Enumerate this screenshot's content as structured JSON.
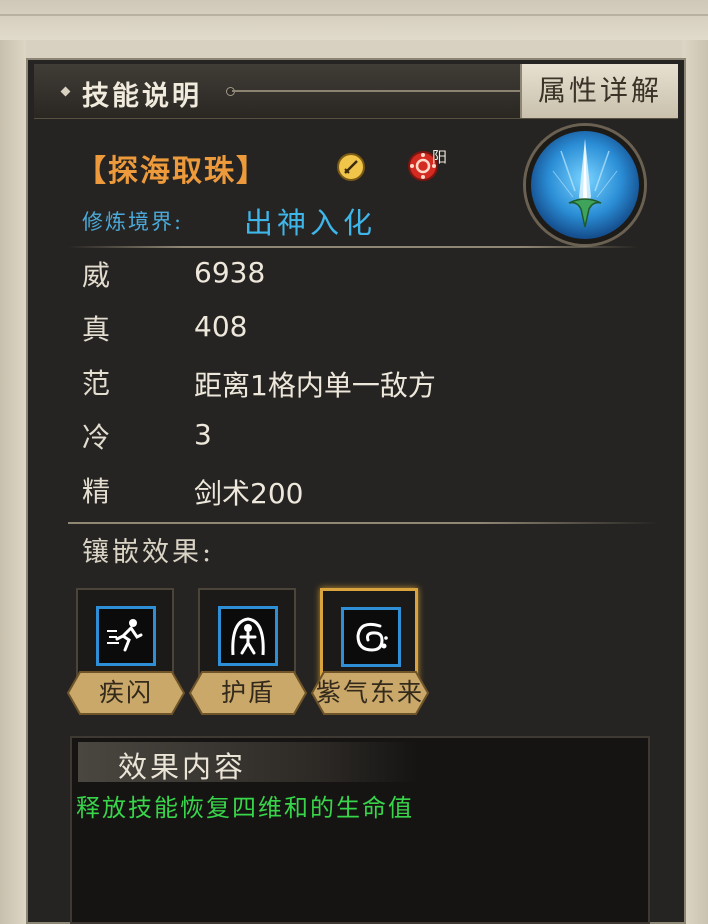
{
  "header": {
    "title": "技能说明",
    "attribute_tab": "属性详解"
  },
  "skill": {
    "name": "【探海取珠】",
    "realm_label": "修炼境界:",
    "realm_value": "出神入化",
    "yang_label": "阳",
    "icons": [
      "sword-type-icon",
      "yang-element-icon",
      "sword-skill-orb-icon"
    ]
  },
  "stats": [
    {
      "key": "威",
      "value": "6938"
    },
    {
      "key": "真",
      "value": "408"
    },
    {
      "key": "范",
      "value": "距离1格内单一敌方"
    },
    {
      "key": "冷",
      "value": "3"
    },
    {
      "key": "精",
      "value": "剑术200"
    }
  ],
  "inlay": {
    "label": "镶嵌效果:",
    "gems": [
      {
        "name": "疾闪",
        "icon": "dash-runner-icon",
        "selected": false
      },
      {
        "name": "护盾",
        "icon": "shield-figure-icon",
        "selected": false
      },
      {
        "name": "紫气东来",
        "icon": "swirl-qi-icon",
        "selected": true
      }
    ]
  },
  "effect": {
    "title": "效果内容",
    "text": "释放技能恢复四维和的生命值"
  },
  "colors": {
    "skill_name": "#ec9a3b",
    "realm": "#3fb6ea",
    "effect_text": "#38d44a",
    "selected_border": "#d9a33d"
  }
}
